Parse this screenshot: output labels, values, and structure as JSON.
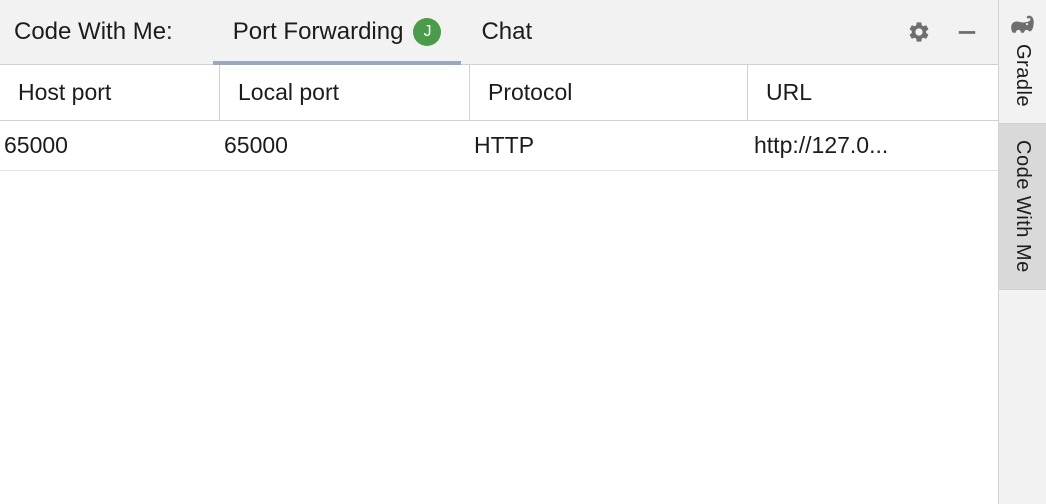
{
  "header": {
    "title": "Code With Me:",
    "tabs": [
      {
        "label": "Port Forwarding",
        "badge": "J",
        "active": true
      },
      {
        "label": "Chat",
        "active": false
      }
    ]
  },
  "table": {
    "columns": [
      "Host port",
      "Local port",
      "Protocol",
      "URL"
    ],
    "rows": [
      {
        "host_port": "65000",
        "local_port": "65000",
        "protocol": "HTTP",
        "url": "http://127.0..."
      }
    ]
  },
  "right_rail": [
    {
      "label": "Gradle",
      "icon": "elephant",
      "active": false
    },
    {
      "label": "Code With Me",
      "icon": null,
      "active": true
    }
  ]
}
